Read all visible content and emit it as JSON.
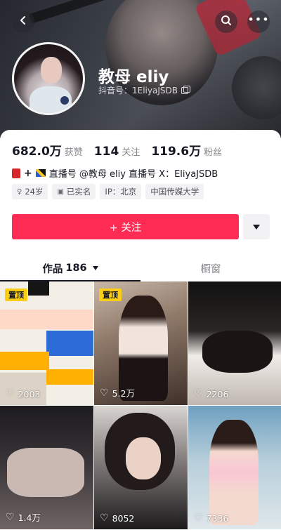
{
  "header": {
    "name": "教母 eliy",
    "douyin_id": "抖音号：1EliyaJSDB"
  },
  "icons": {
    "back": "back-arrow-icon",
    "search": "search-icon",
    "more": "more-dots-icon"
  },
  "stats": [
    {
      "value": "682.0万",
      "label": "获赞"
    },
    {
      "value": "114",
      "label": "关注"
    },
    {
      "value": "119.6万",
      "label": "粉丝"
    }
  ],
  "bio": {
    "text": "直播号 @教母 eliy 直播号  X：EliyaJSDB"
  },
  "tags": [
    {
      "icon": "female-icon",
      "text": "24岁"
    },
    {
      "icon": "id-card-icon",
      "text": "已实名"
    },
    {
      "icon": "",
      "text": "IP：北京"
    },
    {
      "icon": "",
      "text": "中国传媒大学"
    }
  ],
  "actions": {
    "follow_label": "+ 关注"
  },
  "tabs": {
    "works_label": "作品",
    "works_count": "186",
    "window_label": "橱窗"
  },
  "videos": [
    {
      "pinned": "置顶",
      "likes": "2003"
    },
    {
      "pinned": "置顶",
      "likes": "5.2万"
    },
    {
      "pinned": "",
      "likes": "2206"
    },
    {
      "pinned": "",
      "likes": "1.4万"
    },
    {
      "pinned": "",
      "likes": "8052"
    },
    {
      "pinned": "",
      "likes": "7336"
    }
  ],
  "colors": {
    "follow": "#fe2c55",
    "pin": "#face15",
    "text": "#161823",
    "muted": "#86878c"
  }
}
